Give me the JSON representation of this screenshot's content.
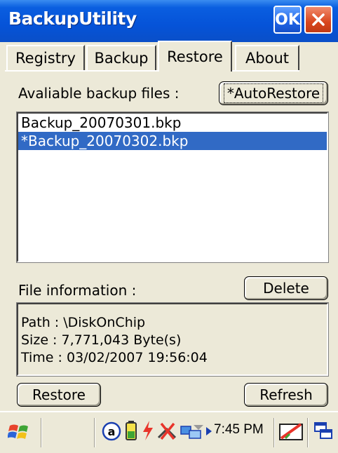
{
  "window": {
    "title": "BackupUtility",
    "ok_label": "OK"
  },
  "tabs": [
    {
      "label": "Registry",
      "active": false
    },
    {
      "label": "Backup",
      "active": false
    },
    {
      "label": "Restore",
      "active": true
    },
    {
      "label": "About",
      "active": false
    }
  ],
  "restore": {
    "available_label": "Avaliable backup files :",
    "autorestore_button": "*AutoRestore",
    "files": [
      {
        "name": "Backup_20070301.bkp",
        "selected": false
      },
      {
        "name": "*Backup_20070302.bkp",
        "selected": true
      }
    ],
    "file_info_label": "File information :",
    "delete_button": "Delete",
    "info": {
      "path": "Path : \\DiskOnChip",
      "size": "Size : 7,771,043 Byte(s)",
      "time": "Time : 03/02/2007 19:56:04"
    },
    "restore_button": "Restore",
    "refresh_button": "Refresh"
  },
  "taskbar": {
    "start_icon": "windows-flag-icon",
    "tray_icons": [
      "at-sign-icon",
      "battery-icon",
      "connectivity-icon",
      "network-icon",
      "arrow-icon"
    ],
    "clock": "7:45 PM"
  },
  "colors": {
    "titlebar": "#0553d8",
    "selection": "#316ac5",
    "face": "#ece9d8"
  }
}
